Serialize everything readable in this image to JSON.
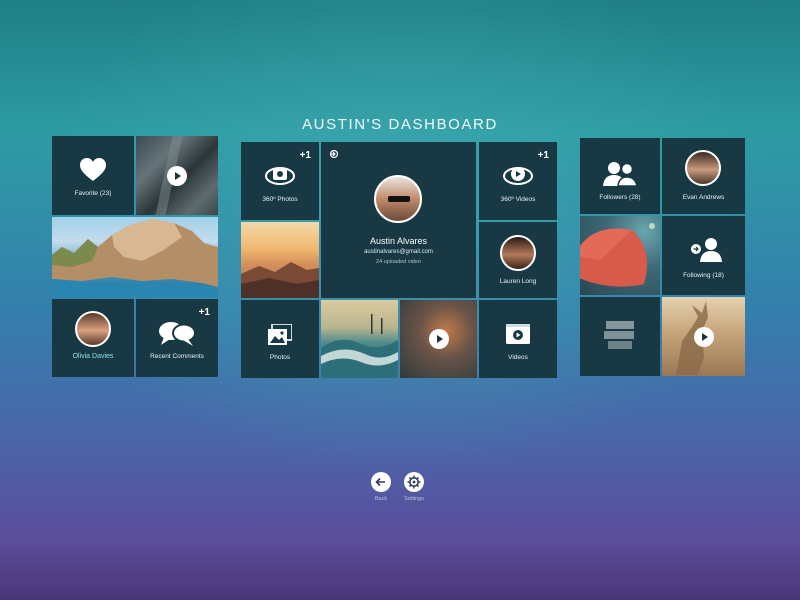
{
  "title": "AUSTIN'S DASHBOARD",
  "colors": {
    "tile": "#183844",
    "accent": "#ffffff",
    "link": "#8fe0ea"
  },
  "left": {
    "favorite_label": "Favorite (23)",
    "recent_comments_label": "Recent Comments",
    "recent_comments_badge": "+1",
    "user_name": "Olivia Davies"
  },
  "center": {
    "photos360_label": "360º Photos",
    "photos360_badge": "+1",
    "videos360_label": "360º Videos",
    "videos360_badge": "+1",
    "profile": {
      "name": "Austin Alvares",
      "email": "austinalvares@gmail.com",
      "uploads": "24 uploaded video"
    },
    "friend_name": "Lauren Long",
    "photos_label": "Photos",
    "videos_label": "Videos"
  },
  "right": {
    "followers_label": "Followers (28)",
    "follower_name": "Evan Andrews",
    "following_label": "Following (18)"
  },
  "footer": {
    "back_label": "Back",
    "settings_label": "Settings"
  }
}
